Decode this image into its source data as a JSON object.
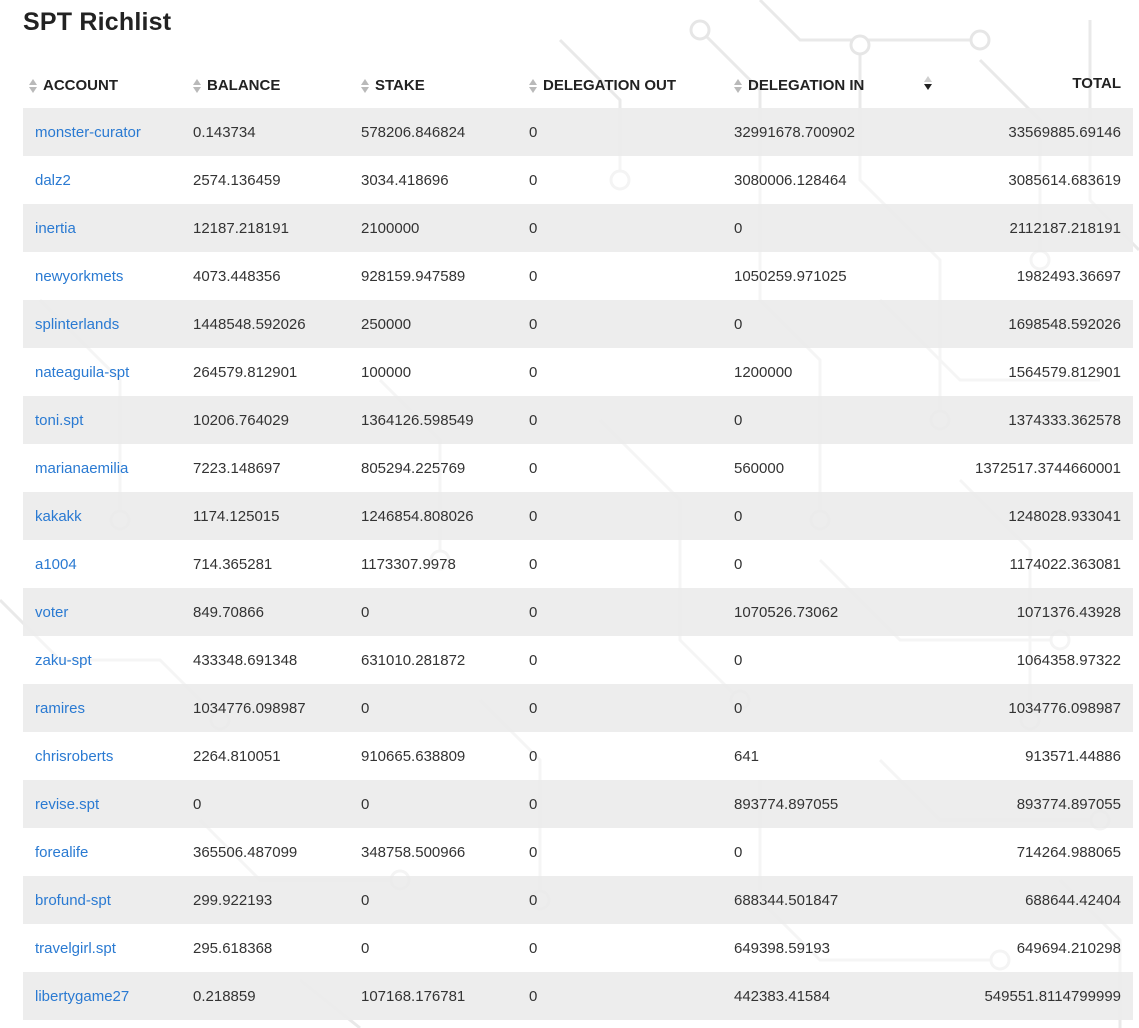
{
  "page": {
    "title": "SPT Richlist"
  },
  "table": {
    "columns": {
      "account": "ACCOUNT",
      "balance": "BALANCE",
      "stake": "STAKE",
      "delegation_out": "DELEGATION OUT",
      "delegation_in": "DELEGATION IN",
      "total": "TOTAL"
    },
    "sort": {
      "column": "TOTAL",
      "direction": "descending"
    },
    "rows": [
      [
        "monster-curator",
        "0.143734",
        "578206.846824",
        "0",
        "32991678.700902",
        "33569885.69146"
      ],
      [
        "dalz2",
        "2574.136459",
        "3034.418696",
        "0",
        "3080006.128464",
        "3085614.683619"
      ],
      [
        "inertia",
        "12187.218191",
        "2100000",
        "0",
        "0",
        "2112187.218191"
      ],
      [
        "newyorkmets",
        "4073.448356",
        "928159.947589",
        "0",
        "1050259.971025",
        "1982493.36697"
      ],
      [
        "splinterlands",
        "1448548.592026",
        "250000",
        "0",
        "0",
        "1698548.592026"
      ],
      [
        "nateaguila-spt",
        "264579.812901",
        "100000",
        "0",
        "1200000",
        "1564579.812901"
      ],
      [
        "toni.spt",
        "10206.764029",
        "1364126.598549",
        "0",
        "0",
        "1374333.362578"
      ],
      [
        "marianaemilia",
        "7223.148697",
        "805294.225769",
        "0",
        "560000",
        "1372517.3744660001"
      ],
      [
        "kakakk",
        "1174.125015",
        "1246854.808026",
        "0",
        "0",
        "1248028.933041"
      ],
      [
        "a1004",
        "714.365281",
        "1173307.9978",
        "0",
        "0",
        "1174022.363081"
      ],
      [
        "voter",
        "849.70866",
        "0",
        "0",
        "1070526.73062",
        "1071376.43928"
      ],
      [
        "zaku-spt",
        "433348.691348",
        "631010.281872",
        "0",
        "0",
        "1064358.97322"
      ],
      [
        "ramires",
        "1034776.098987",
        "0",
        "0",
        "0",
        "1034776.098987"
      ],
      [
        "chrisroberts",
        "2264.810051",
        "910665.638809",
        "0",
        "641",
        "913571.44886"
      ],
      [
        "revise.spt",
        "0",
        "0",
        "0",
        "893774.897055",
        "893774.897055"
      ],
      [
        "forealife",
        "365506.487099",
        "348758.500966",
        "0",
        "0",
        "714264.988065"
      ],
      [
        "brofund-spt",
        "299.922193",
        "0",
        "0",
        "688344.501847",
        "688644.42404"
      ],
      [
        "travelgirl.spt",
        "295.618368",
        "0",
        "0",
        "649398.59193",
        "649694.210298"
      ],
      [
        "libertygame27",
        "0.218859",
        "107168.176781",
        "0",
        "442383.41584",
        "549551.8114799999"
      ]
    ]
  },
  "icons": {
    "sort_idle": "sort-both-icon",
    "sort_active": "sort-descending-icon",
    "background": "circuit-pattern"
  },
  "colors": {
    "link": "#2a7ad2",
    "row_stripe": "#ececec",
    "text": "#333333",
    "heading": "#222222"
  }
}
